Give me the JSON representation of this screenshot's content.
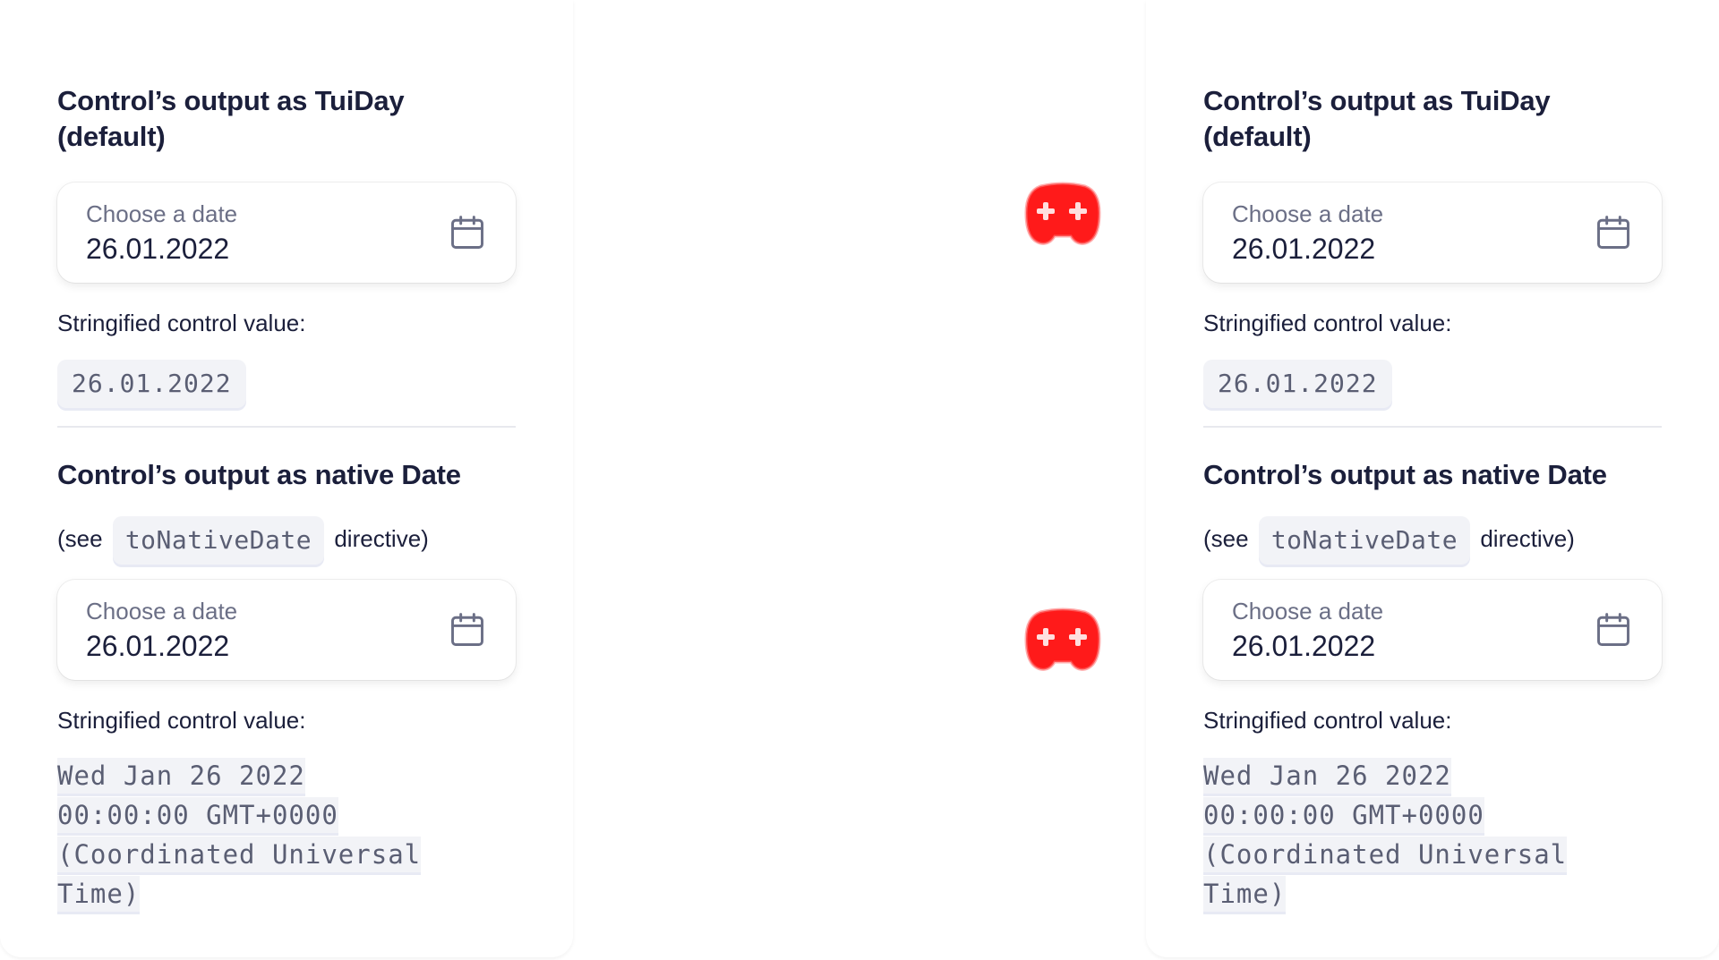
{
  "colors": {
    "text": "#1b1f3b",
    "muted": "#6b6f86",
    "code_bg": "#f2f3f7",
    "gamepad_red": "#ff0000"
  },
  "panels": [
    {
      "tuiday": {
        "title": "Control’s output as TuiDay (default)",
        "field_label": "Choose a date",
        "field_value": "26.01.2022",
        "caption": "Stringified control value:",
        "stringified": "26.01.2022"
      },
      "native": {
        "title": "Control’s output as native Date",
        "see_prefix": "(see",
        "directive_name": "toNativeDate",
        "see_suffix": "directive)",
        "field_label": "Choose a date",
        "field_value": "26.01.2022",
        "caption": "Stringified control value:",
        "stringified": "Wed Jan 26 2022 00:00:00 GMT+0000 (Coordinated Universal Time)"
      }
    },
    {
      "tuiday": {
        "title": "Control’s output as TuiDay (default)",
        "field_label": "Choose a date",
        "field_value": "26.01.2022",
        "caption": "Stringified control value:",
        "stringified": "26.01.2022"
      },
      "native": {
        "title": "Control’s output as native Date",
        "see_prefix": "(see",
        "directive_name": "toNativeDate",
        "see_suffix": "directive)",
        "field_label": "Choose a date",
        "field_value": "26.01.2022",
        "caption": "Stringified control value:",
        "stringified": "Wed Jan 26 2022 00:00:00 GMT+0000 (Coordinated Universal Time)"
      }
    }
  ],
  "icons": {
    "calendar": "calendar-icon",
    "gamepad": "gamepad-icon"
  }
}
